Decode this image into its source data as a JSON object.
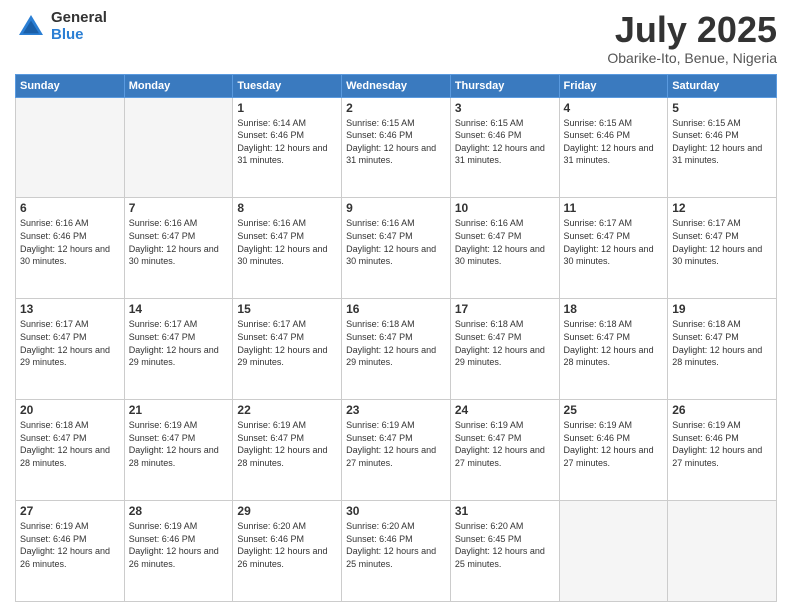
{
  "logo": {
    "general": "General",
    "blue": "Blue"
  },
  "header": {
    "month": "July 2025",
    "location": "Obarike-Ito, Benue, Nigeria"
  },
  "weekdays": [
    "Sunday",
    "Monday",
    "Tuesday",
    "Wednesday",
    "Thursday",
    "Friday",
    "Saturday"
  ],
  "weeks": [
    [
      {
        "day": "",
        "sunrise": "",
        "sunset": "",
        "daylight": "",
        "empty": true
      },
      {
        "day": "",
        "sunrise": "",
        "sunset": "",
        "daylight": "",
        "empty": true
      },
      {
        "day": "1",
        "sunrise": "Sunrise: 6:14 AM",
        "sunset": "Sunset: 6:46 PM",
        "daylight": "Daylight: 12 hours and 31 minutes."
      },
      {
        "day": "2",
        "sunrise": "Sunrise: 6:15 AM",
        "sunset": "Sunset: 6:46 PM",
        "daylight": "Daylight: 12 hours and 31 minutes."
      },
      {
        "day": "3",
        "sunrise": "Sunrise: 6:15 AM",
        "sunset": "Sunset: 6:46 PM",
        "daylight": "Daylight: 12 hours and 31 minutes."
      },
      {
        "day": "4",
        "sunrise": "Sunrise: 6:15 AM",
        "sunset": "Sunset: 6:46 PM",
        "daylight": "Daylight: 12 hours and 31 minutes."
      },
      {
        "day": "5",
        "sunrise": "Sunrise: 6:15 AM",
        "sunset": "Sunset: 6:46 PM",
        "daylight": "Daylight: 12 hours and 31 minutes."
      }
    ],
    [
      {
        "day": "6",
        "sunrise": "Sunrise: 6:16 AM",
        "sunset": "Sunset: 6:46 PM",
        "daylight": "Daylight: 12 hours and 30 minutes."
      },
      {
        "day": "7",
        "sunrise": "Sunrise: 6:16 AM",
        "sunset": "Sunset: 6:47 PM",
        "daylight": "Daylight: 12 hours and 30 minutes."
      },
      {
        "day": "8",
        "sunrise": "Sunrise: 6:16 AM",
        "sunset": "Sunset: 6:47 PM",
        "daylight": "Daylight: 12 hours and 30 minutes."
      },
      {
        "day": "9",
        "sunrise": "Sunrise: 6:16 AM",
        "sunset": "Sunset: 6:47 PM",
        "daylight": "Daylight: 12 hours and 30 minutes."
      },
      {
        "day": "10",
        "sunrise": "Sunrise: 6:16 AM",
        "sunset": "Sunset: 6:47 PM",
        "daylight": "Daylight: 12 hours and 30 minutes."
      },
      {
        "day": "11",
        "sunrise": "Sunrise: 6:17 AM",
        "sunset": "Sunset: 6:47 PM",
        "daylight": "Daylight: 12 hours and 30 minutes."
      },
      {
        "day": "12",
        "sunrise": "Sunrise: 6:17 AM",
        "sunset": "Sunset: 6:47 PM",
        "daylight": "Daylight: 12 hours and 30 minutes."
      }
    ],
    [
      {
        "day": "13",
        "sunrise": "Sunrise: 6:17 AM",
        "sunset": "Sunset: 6:47 PM",
        "daylight": "Daylight: 12 hours and 29 minutes."
      },
      {
        "day": "14",
        "sunrise": "Sunrise: 6:17 AM",
        "sunset": "Sunset: 6:47 PM",
        "daylight": "Daylight: 12 hours and 29 minutes."
      },
      {
        "day": "15",
        "sunrise": "Sunrise: 6:17 AM",
        "sunset": "Sunset: 6:47 PM",
        "daylight": "Daylight: 12 hours and 29 minutes."
      },
      {
        "day": "16",
        "sunrise": "Sunrise: 6:18 AM",
        "sunset": "Sunset: 6:47 PM",
        "daylight": "Daylight: 12 hours and 29 minutes."
      },
      {
        "day": "17",
        "sunrise": "Sunrise: 6:18 AM",
        "sunset": "Sunset: 6:47 PM",
        "daylight": "Daylight: 12 hours and 29 minutes."
      },
      {
        "day": "18",
        "sunrise": "Sunrise: 6:18 AM",
        "sunset": "Sunset: 6:47 PM",
        "daylight": "Daylight: 12 hours and 28 minutes."
      },
      {
        "day": "19",
        "sunrise": "Sunrise: 6:18 AM",
        "sunset": "Sunset: 6:47 PM",
        "daylight": "Daylight: 12 hours and 28 minutes."
      }
    ],
    [
      {
        "day": "20",
        "sunrise": "Sunrise: 6:18 AM",
        "sunset": "Sunset: 6:47 PM",
        "daylight": "Daylight: 12 hours and 28 minutes."
      },
      {
        "day": "21",
        "sunrise": "Sunrise: 6:19 AM",
        "sunset": "Sunset: 6:47 PM",
        "daylight": "Daylight: 12 hours and 28 minutes."
      },
      {
        "day": "22",
        "sunrise": "Sunrise: 6:19 AM",
        "sunset": "Sunset: 6:47 PM",
        "daylight": "Daylight: 12 hours and 28 minutes."
      },
      {
        "day": "23",
        "sunrise": "Sunrise: 6:19 AM",
        "sunset": "Sunset: 6:47 PM",
        "daylight": "Daylight: 12 hours and 27 minutes."
      },
      {
        "day": "24",
        "sunrise": "Sunrise: 6:19 AM",
        "sunset": "Sunset: 6:47 PM",
        "daylight": "Daylight: 12 hours and 27 minutes."
      },
      {
        "day": "25",
        "sunrise": "Sunrise: 6:19 AM",
        "sunset": "Sunset: 6:46 PM",
        "daylight": "Daylight: 12 hours and 27 minutes."
      },
      {
        "day": "26",
        "sunrise": "Sunrise: 6:19 AM",
        "sunset": "Sunset: 6:46 PM",
        "daylight": "Daylight: 12 hours and 27 minutes."
      }
    ],
    [
      {
        "day": "27",
        "sunrise": "Sunrise: 6:19 AM",
        "sunset": "Sunset: 6:46 PM",
        "daylight": "Daylight: 12 hours and 26 minutes."
      },
      {
        "day": "28",
        "sunrise": "Sunrise: 6:19 AM",
        "sunset": "Sunset: 6:46 PM",
        "daylight": "Daylight: 12 hours and 26 minutes."
      },
      {
        "day": "29",
        "sunrise": "Sunrise: 6:20 AM",
        "sunset": "Sunset: 6:46 PM",
        "daylight": "Daylight: 12 hours and 26 minutes."
      },
      {
        "day": "30",
        "sunrise": "Sunrise: 6:20 AM",
        "sunset": "Sunset: 6:46 PM",
        "daylight": "Daylight: 12 hours and 25 minutes."
      },
      {
        "day": "31",
        "sunrise": "Sunrise: 6:20 AM",
        "sunset": "Sunset: 6:45 PM",
        "daylight": "Daylight: 12 hours and 25 minutes."
      },
      {
        "day": "",
        "sunrise": "",
        "sunset": "",
        "daylight": "",
        "empty": true
      },
      {
        "day": "",
        "sunrise": "",
        "sunset": "",
        "daylight": "",
        "empty": true
      }
    ]
  ]
}
